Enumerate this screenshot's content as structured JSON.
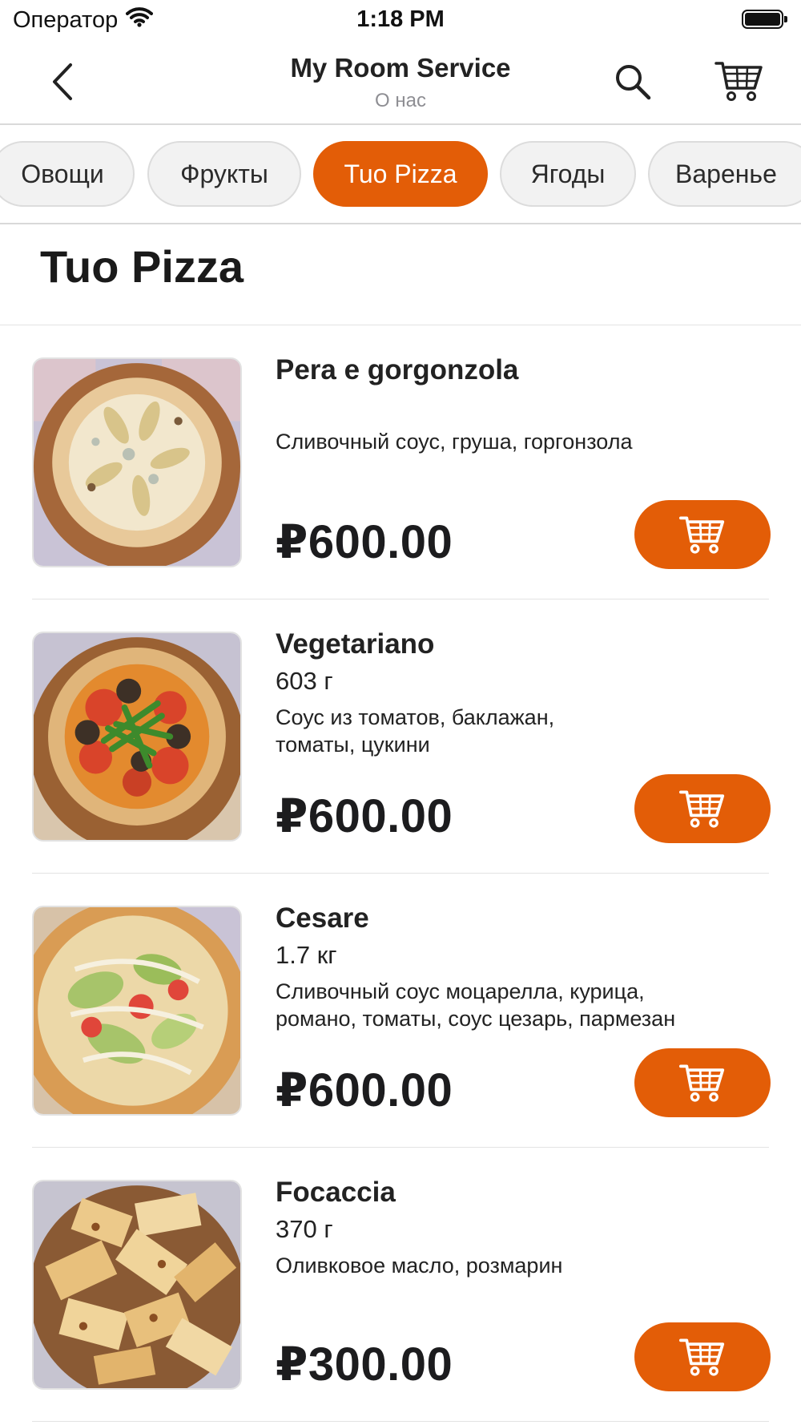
{
  "status_bar": {
    "carrier": "Оператор",
    "time": "1:18 PM"
  },
  "nav": {
    "title": "My Room Service",
    "subtitle": "О нас"
  },
  "categories": [
    "Овощи",
    "Фрукты",
    "Tuo Pizza",
    "Ягоды",
    "Варенье"
  ],
  "active_category": "Tuo Pizza",
  "section_title": "Tuo Pizza",
  "products": [
    {
      "name": "Pera e gorgonzola",
      "weight": "",
      "description_lines": [
        "Сливочный соус, груша, горгонзола"
      ],
      "price": "₽600.00"
    },
    {
      "name": "Vegetariano",
      "weight": "603 г",
      "description_lines": [
        "Соус из томатов, баклажан,",
        "томаты, цукини"
      ],
      "price": "₽600.00"
    },
    {
      "name": "Cesare",
      "weight": "1.7 кг",
      "description_lines": [
        "Сливочный соус моцарелла, курица,",
        "романо, томаты, соус цезарь, пармезан"
      ],
      "price": "₽600.00"
    },
    {
      "name": "Focaccia",
      "weight": "370 г",
      "description_lines": [
        "Оливковое масло, розмарин"
      ],
      "price": "₽300.00"
    }
  ],
  "colors": {
    "accent": "#e35d07",
    "chip_bg": "#f2f2f2",
    "divider": "#d9d9d9"
  },
  "icons": [
    "back-chevron-icon",
    "search-icon",
    "cart-icon",
    "wifi-icon",
    "battery-icon"
  ]
}
